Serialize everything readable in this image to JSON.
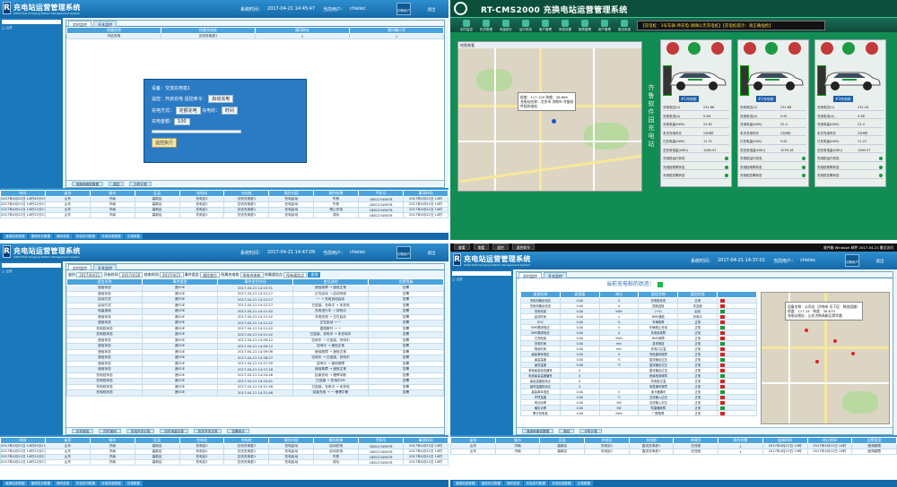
{
  "app": {
    "title": "充电站运营管理系统",
    "subtitle": "Qdbit Fast Charging Station Management System",
    "logo_letter": "R",
    "time_label": "系统时间：",
    "user_label": "当前用户：",
    "user": "chielec",
    "switch_user": "切换用户",
    "exit": "退出"
  },
  "q1": {
    "time": "2017-04-21 14:45:47",
    "tree": [
      "□ 山东",
      "□ 济南",
      "□ 重汽站",
      "□ 高新站",
      "高新站",
      "高新站",
      "高新站",
      "高新站",
      "高新站",
      "高新站",
      "高新站",
      "高新站",
      "高新站",
      "高新站",
      "高新站",
      "高新站",
      "高新站",
      "高新站",
      "高新站",
      "广东"
    ],
    "tabs": [
      "实时监控",
      "开关监控"
    ],
    "grid_headers": [
      "终端名称",
      "所属充电桩",
      "通讯地址",
      "通讯端口号"
    ],
    "grid_row": [
      "开启充电",
      "交流充电桩1",
      "1",
      "1"
    ],
    "dialog": {
      "device_label": "设备：",
      "device": "交流充电桩1",
      "remote_label": "遥控：",
      "remote": "开启充电 遥控命令：",
      "cmd": "启动充电",
      "mode_label": "充电方式：",
      "mode": "定额充电",
      "mode2": "充电的：",
      "unit": "时间",
      "amount_label": "充电金额：",
      "amount": "100",
      "go": "遥控执行"
    },
    "pager": [
      "遥测和遥信数据",
      "遥控",
      "分时计费"
    ],
    "log_headers": [
      "时间",
      "省份",
      "城市",
      "区县",
      "充电站",
      "充电桩",
      "操作内容",
      "操作结果",
      "手机号",
      "事项时间"
    ],
    "log_rows": [
      [
        "2017年4月21日 14时45分19秒",
        "山东",
        "济南",
        "高新区",
        "充电站1",
        "交流充电桩1",
        "充电启动",
        "失败",
        "18812345678",
        "2017年4月21日 14时"
      ],
      [
        "2017年4月21日 14时12分27秒",
        "山东",
        "济南",
        "高新区",
        "充电站1",
        "交流充电桩1",
        "充电启动",
        "失败",
        "18812345678",
        "2017年4月21日 14时"
      ],
      [
        "2017年4月21日 14时12分27秒",
        "山东",
        "济南",
        "高新区",
        "充电站1",
        "交流充电桩1",
        "充电启动",
        "停止充电",
        "18812345678",
        "2017年4月21日 14时"
      ],
      [
        "2017年4月21日 14时12分27秒",
        "山东",
        "济南",
        "高新区",
        "充电站1",
        "交流充电桩1",
        "充电启动",
        "成功",
        "18812345678",
        "2017年4月21日 14时"
      ]
    ],
    "bottom_tabs": [
      "遥测信息数据",
      "遥测历史数据",
      "操作信息",
      "充电实时数据",
      "充电信息数据",
      "交易数据"
    ]
  },
  "q2": {
    "title": "RT-CMS2000 充换电站运营管理系统",
    "menu": [
      "实时监控",
      "历史数据",
      "电量统计",
      "运行状态",
      "客户管理",
      "系统设置",
      "报表管理",
      "用户管理",
      "退出系统"
    ],
    "ticker": "【充电桩：3号车辆-待充电-请确认无充电桩】【充电桩提示：请正确插枪】",
    "map_title": "地图查看",
    "pop": [
      "经度：117.129 纬度：36.689",
      "充电站名称：北京市 济南市 齐鲁软",
      "件园充电站"
    ],
    "vtext": "齐鲁软件园充电站",
    "stations": [
      {
        "label": "#1充电桩",
        "rows": [
          [
            "充电电压(V)",
            "231.68"
          ],
          [
            "充电电流(A)",
            "9.66"
          ],
          [
            "充电电量(kWh)",
            "22.62"
          ],
          [
            "本次充电时长",
            "2分6秒"
          ],
          [
            "已充电量(kWh)",
            "11.31"
          ],
          [
            "总充电电量(kWh)",
            "1080.07"
          ],
          [
            "充电桩运行状态",
            ""
          ],
          [
            "充电桩故障状态",
            ""
          ],
          [
            "充电桩告警状态",
            ""
          ]
        ]
      },
      {
        "label": "#2充电桩",
        "rows": [
          [
            "充电电压(V)",
            "231.88"
          ],
          [
            "充电电流(A)",
            "9.61"
          ],
          [
            "充电电量(kWh)",
            "22.4"
          ],
          [
            "本次充电时长",
            "2分6秒"
          ],
          [
            "已充电量(kWh)",
            "9.61"
          ],
          [
            "总充电电量(kWh)",
            "1078.16"
          ],
          [
            "充电桩运行状态",
            ""
          ],
          [
            "充电桩故障状态",
            ""
          ],
          [
            "充电桩告警状态",
            ""
          ]
        ]
      },
      {
        "label": "#3充电桩",
        "rows": [
          [
            "充电电压(V)",
            "231.18"
          ],
          [
            "充电电流(A)",
            "9.68"
          ],
          [
            "充电电量(kWh)",
            "22.4"
          ],
          [
            "本次充电时长",
            "2分6秒"
          ],
          [
            "已充电量(kWh)",
            "11.23"
          ],
          [
            "总充电电量(kWh)",
            "1080.07"
          ],
          [
            "充电桩运行状态",
            ""
          ],
          [
            "充电桩故障状态",
            ""
          ],
          [
            "充电桩告警状态",
            ""
          ]
        ]
      }
    ]
  },
  "q3": {
    "time": "2017-04-21 14:47:09",
    "tree": [
      "□ 山东",
      "□ 济南",
      "□ 重汽站",
      "高新站",
      "高新站",
      "高新站",
      "高新站",
      "高新站",
      "高新站",
      "高新站",
      "高新站",
      "高新站",
      "高新站",
      "□ 高新站",
      "高新站",
      "高新站",
      "高新站",
      "广东"
    ],
    "tabs": [
      "实时监控",
      "开关监控"
    ],
    "filter": {
      "t1": "省份",
      "v1": "2017/04/21",
      "t2": "开始时间",
      "v2": "2017/4/20",
      "t3": "结束时间",
      "v3": "2017/4/21",
      "t4": "事件类型",
      "v4": "遥信变位",
      "t5": "所属充电桩",
      "v5": "所有充电桩",
      "t6": "所属遥信点",
      "v6": "所有遥信点",
      "btn": "查询"
    },
    "headers": [
      "遥信名称",
      "事件类型",
      "事件发生时间",
      "变位说明",
      "告警等级"
    ],
    "rows": [
      [
        "遥信状态",
        "遥SOE",
        "2017-04-21 14:15:31",
        "遥信故障 → 遥信正常",
        "告警"
      ],
      [
        "遥信状态",
        "遥SOE",
        "2017-04-21 14:12:27",
        "正在启动 → 启动完成",
        "告警"
      ],
      [
        "启动方式",
        "遥SOE",
        "2017-04-21 14:12:27",
        "一 → 充电自动启动",
        "告警"
      ],
      [
        "启动方式",
        "遥SOE",
        "2017-04-21 14:12:27",
        "已连接，充电中 → 未充电",
        "告警"
      ],
      [
        "电量查询",
        "遥SOE",
        "2017-04-21 14:11:42",
        "充电进行中 → 待机中",
        "告警"
      ],
      [
        "遥信状态",
        "遥SOE",
        "2017-04-21 14:11:42",
        "充电完成 → 正在启动",
        "告警"
      ],
      [
        "遥信状态",
        "遥SOE",
        "2017-04-21 14:11:42",
        "正在启动 → 一",
        "告警"
      ],
      [
        "充电桩状态",
        "遥SOE",
        "2017-04-21 14:11:42",
        "直插断开 → 一",
        "告警"
      ],
      [
        "充电桩状态",
        "遥SOE",
        "2017-04-21 14:11:42",
        "已连接，充电中 → 未充电中",
        "告警"
      ],
      [
        "遥信状态",
        "遥SOE",
        "2017-04-21 14:09:12",
        "空闲中 → 已连接，充电中",
        "告警"
      ],
      [
        "遥信状态",
        "遥SOE",
        "2017-04-21 14:09:12",
        "空闲中 → 遥信正常",
        "告警"
      ],
      [
        "遥信状态",
        "遥SOE",
        "2017-04-21 14:09:06",
        "遥信故障 → 遥信正常",
        "告警"
      ],
      [
        "遥信状态",
        "遥SOE",
        "2017-04-21 14:28:27",
        "空闲中 → 已连接，充电中",
        "告警"
      ],
      [
        "遥信状态",
        "遥SOE",
        "2017-04-21 14:27:39",
        "空闲中 → 遥信故障",
        "告警"
      ],
      [
        "遥信状态",
        "遥SOE",
        "2017-04-21 14:27:18",
        "遥信故障 → 遥信正常",
        "告警"
      ],
      [
        "充电桩状态",
        "遥SOE",
        "2017-04-21 14:24:46",
        "结束充电 → 慢停中断",
        "告警"
      ],
      [
        "充电桩状态",
        "遥SOE",
        "2017-04-21 14:24:41",
        "已连接 → 充电中VR",
        "告警"
      ],
      [
        "充电桩状态",
        "遥SOE",
        "2017-04-21 14:21:46",
        "已连接，充电中 → 未充电",
        "告警"
      ],
      [
        "充电桩状态",
        "遥SOE",
        "2017-04-21 14:21:46",
        "结束充电 → 一 慢停中断",
        "告警"
      ]
    ],
    "pager": [
      "历史遥信",
      "历史遥测",
      "充电开关记录",
      "历史电量记录",
      "历史开关记录",
      "告警统计"
    ],
    "log_headers": [
      "时间",
      "省份",
      "城市",
      "区县",
      "充电站",
      "充电桩",
      "操作内容",
      "操作结果",
      "手机号",
      "事项时间"
    ],
    "log_rows": [
      [
        "2017年4月21日 14时45分19秒",
        "山东",
        "济南",
        "高新区",
        "充电站1",
        "交流充电桩1",
        "充电启动",
        "启动充电",
        "18812345678",
        "2017年4月21日 14时"
      ],
      [
        "2017年4月21日 14时12分27秒",
        "山东",
        "济南",
        "高新区",
        "充电站1",
        "交流充电桩1",
        "充电启动",
        "启动充电",
        "18812345678",
        "2017年4月21日 14时"
      ],
      [
        "2017年4月21日 14时12分27秒",
        "山东",
        "济南",
        "高新区",
        "充电站1",
        "交流充电桩1",
        "充电启动",
        "失败",
        "18812345678",
        "2017年4月21日 14时"
      ],
      [
        "2017年4月21日 14时12分27秒",
        "山东",
        "济南",
        "高新区",
        "充电站1",
        "交流充电桩1",
        "充电启动",
        "成功",
        "18812345678",
        "2017年4月21日 14时"
      ]
    ],
    "bottom_tabs": [
      "遥测信息数据",
      "遥测历史数据",
      "操作信息",
      "充电实时数据",
      "充电信息数据",
      "交易数据"
    ]
  },
  "q4": {
    "time": "2017-04-21 14:37:01",
    "topbar": [
      "查看",
      "查看",
      "遥控",
      "遥控命令"
    ],
    "winbar": "收件箱 Windows 邮件 2017-04-21 最近访问",
    "tabs": [
      "实时监控",
      "开关监控"
    ],
    "status_label": "当前充电桩的状态：",
    "headers": [
      "遥测名称",
      "遥测值",
      "单位",
      "遥信名称",
      "遥信状态"
    ],
    "rows": [
      [
        "充电机输出电压",
        "0.00",
        "V",
        "充电桩状态",
        "空闲"
      ],
      [
        "充电机输出电流",
        "0.00",
        "A",
        "插枪连接",
        "未连接"
      ],
      [
        "充电电量",
        "0.00",
        "kWh",
        "(+V)",
        "启动"
      ],
      [
        "启动时间",
        "0.00",
        "s",
        "BMS通信",
        "充电中"
      ],
      [
        "SOC",
        "0.00",
        "%",
        "车辆故障",
        "正常"
      ],
      [
        "BMS需求电压",
        "0.00",
        "V",
        "车辆禁止充电",
        "正常"
      ],
      [
        "BMS需求电流",
        "0.00",
        "A",
        "充电机故障",
        "正常"
      ],
      [
        "已充电量",
        "0.00",
        "kWh",
        "BMS故障",
        "正常"
      ],
      [
        "充电时间",
        "0.00",
        "min",
        "急停按钮",
        "正常"
      ],
      [
        "剩余时间",
        "0.00",
        "min",
        "充电口过温",
        "正常"
      ],
      [
        "最高单体电压",
        "0.00",
        "V",
        "充电模块故障",
        "正常"
      ],
      [
        "最高温度",
        "0.00",
        "℃",
        "直流输出过压",
        "正常"
      ],
      [
        "最低温度",
        "0.00",
        "℃",
        "直流输出欠压",
        "正常"
      ],
      [
        "单体最高电压编号",
        "0",
        "",
        "直流输出过流",
        "正常"
      ],
      [
        "电池最高温度编号",
        "0",
        "",
        "绝缘检测故障",
        "正常"
      ],
      [
        "最高温度检测点",
        "0",
        "",
        "充电桩过温",
        "正常"
      ],
      [
        "最低温度检测点",
        "0",
        "",
        "电表通讯故障",
        "正常"
      ],
      [
        "最高单体电压",
        "0.00",
        "V",
        "读卡器通讯",
        "正常"
      ],
      [
        "环境温度",
        "0.00",
        "℃",
        "交流输入过压",
        "正常"
      ],
      [
        "有功功率",
        "0.00",
        "kW",
        "交流输入欠压",
        "正常"
      ],
      [
        "输出功率",
        "0.00",
        "kW",
        "防雷器故障",
        "正常"
      ],
      [
        "累计充电量",
        "0.00",
        "kWh",
        "门禁故障",
        "正常"
      ]
    ],
    "pop": [
      "设备名称：公司站（济南市 历下区 · 稀金园路）",
      "经度：117.14 · 纬度：36.679",
      "充电站地址：山东济南高新区舜华路"
    ],
    "pager": [
      "遥测和遥信数据",
      "遥控",
      "分时计费"
    ],
    "log_headers": [
      "省份",
      "城市",
      "区县",
      "充电站",
      "充电桩",
      "终端号",
      "操作次数",
      "起始时间",
      "终止时间",
      "告警类型"
    ],
    "log_rows": [
      [
        "山东",
        "济南",
        "高新区",
        "充电站1",
        "直流充电桩1",
        "交流桩",
        "1",
        "2017年4月21日 14时",
        "2017年4月21日 14时",
        "遥测越限"
      ],
      [
        "山东",
        "济南",
        "高新区",
        "充电站1",
        "直流充电桩1",
        "交流桩",
        "1",
        "2017年4月21日 14时",
        "2017年4月21日 14时",
        "遥测越限"
      ]
    ],
    "bottom_tabs": [
      "遥测信息数据",
      "遥测历史数据",
      "操作信息",
      "充电实时数据",
      "充电信息数据",
      "交易数据"
    ]
  }
}
